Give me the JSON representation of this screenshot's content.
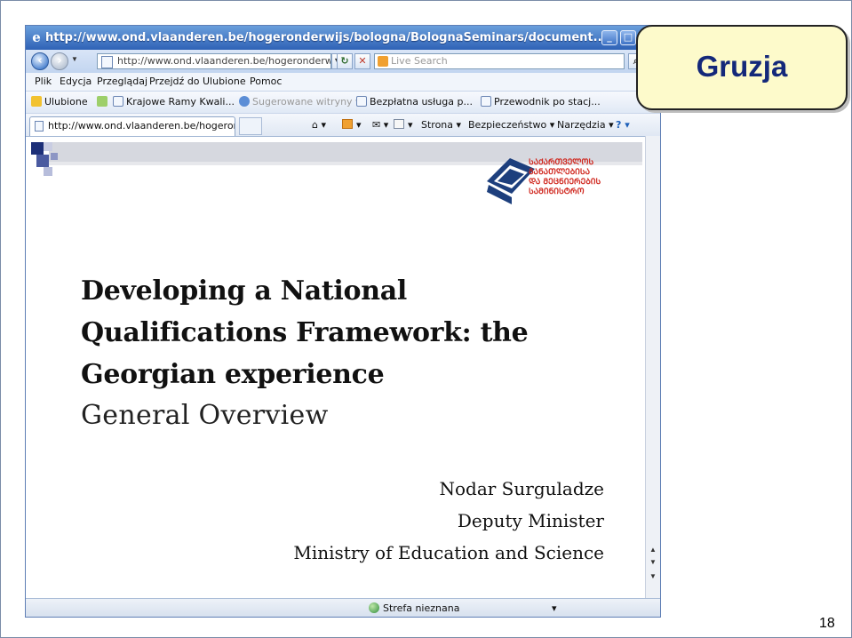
{
  "slide": {
    "callout_title": "Gruzja",
    "page_number": "18"
  },
  "browser": {
    "window_title": "http://www.ond.vlaanderen.be/hogeronderwijs/bologna/BolognaSeminars/document...",
    "address_url": "http://www.ond.vlaanderen.be/hogeronderwijs/",
    "search_placeholder": "Live Search",
    "menu": [
      "Plik",
      "Edycja",
      "Przeglądaj",
      "Przejdź do",
      "Ulubione",
      "Pomoc"
    ],
    "favorites": {
      "label": "Ulubione",
      "items": [
        "Krajowe Ramy Kwali...",
        "Sugerowane witryny",
        "Bezpłatna usługa p...",
        "Przewodnik po stacj..."
      ]
    },
    "tab_title": "http://www.ond.vlaanderen.be/hogeronder...",
    "commands": [
      "Strona",
      "Bezpieczeństwo",
      "Narzędzia"
    ],
    "status_zone": "Strefa nieznana"
  },
  "document": {
    "headline_lines": [
      "Developing a National",
      "Qualifications Framework: the",
      "Georgian experience"
    ],
    "subtitle": "General Overview",
    "author": "Nodar Surguladze",
    "position": "Deputy Minister",
    "ministry": "Ministry of Education and Science",
    "logo_text_lines": [
      "ᲡᲐᲥᲐᲠᲗᲕᲔᲚᲝᲡ",
      "ᲒᲐᲜᲐᲗᲚᲔᲑᲘᲡᲐ",
      "ᲓᲐ ᲛᲔᲪᲜᲘᲔᲠᲔᲑᲘᲡ",
      "ᲡᲐᲛᲘᲜᲘᲡᲢᲠᲝ"
    ]
  },
  "colors": {
    "callout_fill": "#fdfacb",
    "callout_text": "#14287a",
    "titlebar": "#2f62b6",
    "logo_red": "#d0281f",
    "logo_blue": "#1d3f7d"
  }
}
